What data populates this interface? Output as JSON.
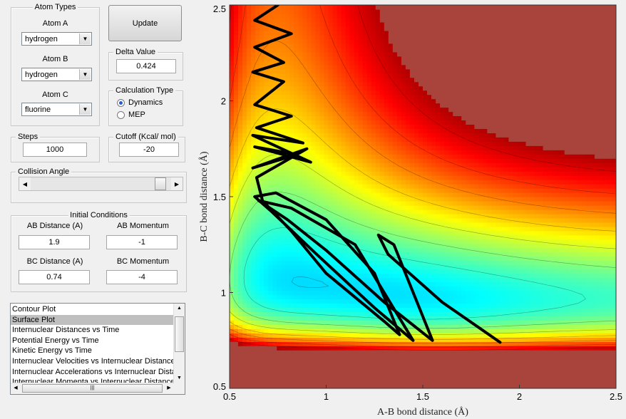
{
  "atom_types": {
    "title": "Atom Types",
    "atom_a": {
      "label": "Atom A",
      "value": "hydrogen"
    },
    "atom_b": {
      "label": "Atom B",
      "value": "hydrogen"
    },
    "atom_c": {
      "label": "Atom C",
      "value": "fluorine"
    }
  },
  "update_button": "Update",
  "delta": {
    "title": "Delta Value",
    "value": "0.424"
  },
  "calc_type": {
    "title": "Calculation Type",
    "options": [
      "Dynamics",
      "MEP"
    ],
    "selected": "Dynamics"
  },
  "steps": {
    "title": "Steps",
    "value": "1000"
  },
  "cutoff": {
    "title": "Cutoff (Kcal/ mol)",
    "value": "-20"
  },
  "collision_angle": {
    "title": "Collision Angle",
    "fraction": 0.96
  },
  "initial_conditions": {
    "title": "Initial Conditions",
    "ab_distance": {
      "label": "AB Distance (A)",
      "value": "1.9"
    },
    "ab_momentum": {
      "label": "AB Momentum",
      "value": "-1"
    },
    "bc_distance": {
      "label": "BC Distance (A)",
      "value": "0.74"
    },
    "bc_momentum": {
      "label": "BC Momentum",
      "value": "-4"
    }
  },
  "plot_list": {
    "items": [
      "Contour Plot",
      "Surface Plot",
      "Internuclear Distances vs Time",
      "Potential Energy vs Time",
      "Kinetic Energy vs Time",
      "Internuclear Velocities vs Internuclear Distances",
      "Internuclear Accelerations vs Internuclear Distances",
      "Internuclear Momenta vs Internuclear Distances"
    ],
    "selected_index": 1
  },
  "chart_data": {
    "type": "heatmap",
    "title": "",
    "xlabel": "A-B bond distance (Å)",
    "ylabel": "B-C bond distance (Å)",
    "xlim": [
      0.5,
      2.5
    ],
    "ylim": [
      0.5,
      2.5
    ],
    "xticks": [
      "0.5",
      "1",
      "1.5",
      "2",
      "2.5"
    ],
    "yticks": [
      "0.5",
      "1",
      "1.5",
      "2",
      "2.5"
    ],
    "colormap": "jet",
    "valley_minimum": [
      1.6,
      0.97
    ],
    "trajectory": [
      [
        1.9,
        0.74
      ],
      [
        1.6,
        0.95
      ],
      [
        1.32,
        1.2
      ],
      [
        1.27,
        1.3
      ],
      [
        1.35,
        1.25
      ],
      [
        1.55,
        0.75
      ],
      [
        1.3,
        0.95
      ],
      [
        1.0,
        1.22
      ],
      [
        0.8,
        1.38
      ],
      [
        0.65,
        1.48
      ],
      [
        0.82,
        1.44
      ],
      [
        1.15,
        1.25
      ],
      [
        1.45,
        0.75
      ],
      [
        1.25,
        0.92
      ],
      [
        0.95,
        1.2
      ],
      [
        0.72,
        1.42
      ],
      [
        0.63,
        1.5
      ],
      [
        0.74,
        1.52
      ],
      [
        1.0,
        1.38
      ],
      [
        1.25,
        1.1
      ],
      [
        1.38,
        0.78
      ],
      [
        1.3,
        0.85
      ],
      [
        1.0,
        1.1
      ],
      [
        0.82,
        1.32
      ],
      [
        0.67,
        1.48
      ],
      [
        0.64,
        1.6
      ],
      [
        0.9,
        1.75
      ],
      [
        0.62,
        1.65
      ],
      [
        0.85,
        1.72
      ],
      [
        0.63,
        1.76
      ],
      [
        0.92,
        1.68
      ],
      [
        0.62,
        1.82
      ],
      [
        0.88,
        1.78
      ],
      [
        0.64,
        1.86
      ],
      [
        0.82,
        1.92
      ],
      [
        0.63,
        1.98
      ],
      [
        0.78,
        2.1
      ],
      [
        0.62,
        2.15
      ],
      [
        0.78,
        2.2
      ],
      [
        0.63,
        2.28
      ],
      [
        0.82,
        2.35
      ],
      [
        0.63,
        2.42
      ],
      [
        0.75,
        2.5
      ]
    ]
  }
}
